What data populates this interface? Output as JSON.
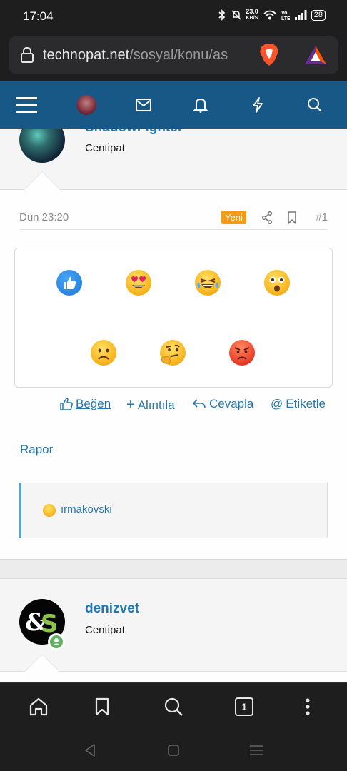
{
  "status_bar": {
    "time": "17:04",
    "speed_value": "23.0",
    "speed_unit": "KB/S",
    "battery": "28",
    "icons": [
      "bluetooth-icon",
      "mute-icon",
      "wifi-icon",
      "volte-icon",
      "signal-icon",
      "battery-icon"
    ]
  },
  "browser": {
    "url_host": "technopat.net",
    "url_path": "/sosyal/konu/as",
    "tab_count": "1"
  },
  "nav": {
    "items": [
      "menu-icon",
      "avatar",
      "inbox-icon",
      "alerts-icon",
      "whats-new-icon",
      "search-icon"
    ]
  },
  "post": {
    "author": {
      "name": "ShadowFighter",
      "title": "Centipat"
    },
    "date": "Dün 23:20",
    "new_badge": "Yeni",
    "number": "#1",
    "reactions_picker": [
      "like",
      "love",
      "haha",
      "wow",
      "sad",
      "thinking",
      "angry"
    ],
    "actions": {
      "like": "Beğen",
      "quote": "Alıntıla",
      "reply": "Cevapla",
      "mention": "Etiketle"
    },
    "report": "Rapor",
    "reacted_by": "ırmakovski"
  },
  "next_post": {
    "author": {
      "name": "denizvet",
      "title": "Centipat"
    }
  },
  "colors": {
    "nav_bg": "#185886",
    "link": "#2577b1",
    "badge": "#f39c12",
    "online": "#63b265"
  }
}
